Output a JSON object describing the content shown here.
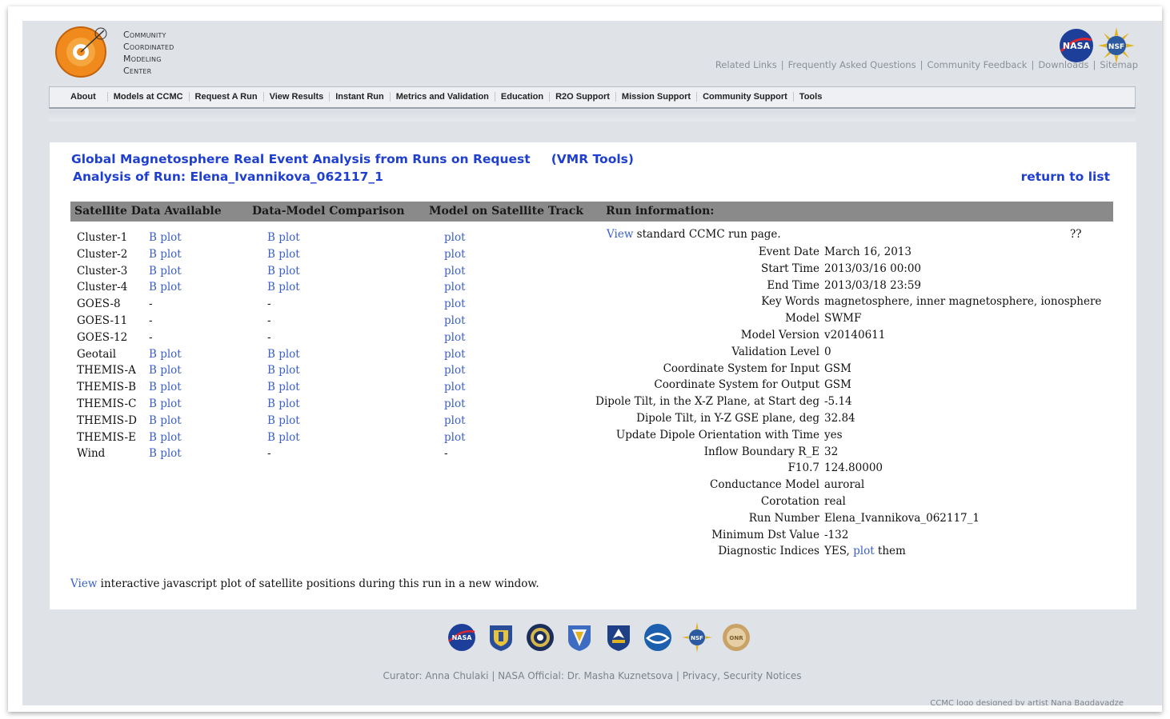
{
  "logo": {
    "lines": [
      "Community",
      "Coordinated",
      "Modeling",
      "Center"
    ]
  },
  "top_links": [
    "Related Links",
    "Frequently Asked Questions",
    "Community Feedback",
    "Downloads",
    "Sitemap"
  ],
  "nav": [
    "About",
    "Models at CCMC",
    "Request A Run",
    "View Results",
    "Instant Run",
    "Metrics and Validation",
    "Education",
    "R2O Support",
    "Mission Support",
    "Community Support",
    "Tools"
  ],
  "header": {
    "title": "Global Magnetosphere Real Event Analysis from Runs on Request",
    "vmr": "(VMR Tools)",
    "run_title": "Analysis of Run: Elena_Ivannikova_062117_1",
    "return": "return to list"
  },
  "table_headers": [
    "Satellite Data Available",
    "Data-Model Comparison",
    "Model on Satellite Track",
    "Run information:"
  ],
  "satellites": [
    {
      "name": "Cluster-1",
      "data": "B plot",
      "comparison": "B plot",
      "track": "plot"
    },
    {
      "name": "Cluster-2",
      "data": "B plot",
      "comparison": "B plot",
      "track": "plot"
    },
    {
      "name": "Cluster-3",
      "data": "B plot",
      "comparison": "B plot",
      "track": "plot"
    },
    {
      "name": "Cluster-4",
      "data": "B plot",
      "comparison": "B plot",
      "track": "plot"
    },
    {
      "name": "GOES-8",
      "data": "-",
      "comparison": "-",
      "track": "plot"
    },
    {
      "name": "GOES-11",
      "data": "-",
      "comparison": "-",
      "track": "plot"
    },
    {
      "name": "GOES-12",
      "data": "-",
      "comparison": "-",
      "track": "plot"
    },
    {
      "name": "Geotail",
      "data": "B plot",
      "comparison": "B plot",
      "track": "plot"
    },
    {
      "name": "THEMIS-A",
      "data": "B plot",
      "comparison": "B plot",
      "track": "plot"
    },
    {
      "name": "THEMIS-B",
      "data": "B plot",
      "comparison": "B plot",
      "track": "plot"
    },
    {
      "name": "THEMIS-C",
      "data": "B plot",
      "comparison": "B plot",
      "track": "plot"
    },
    {
      "name": "THEMIS-D",
      "data": "B plot",
      "comparison": "B plot",
      "track": "plot"
    },
    {
      "name": "THEMIS-E",
      "data": "B plot",
      "comparison": "B plot",
      "track": "plot"
    },
    {
      "name": "Wind",
      "data": "B plot",
      "comparison": "-",
      "track": "-"
    }
  ],
  "run_page": {
    "link": "View",
    "text": " standard CCMC run page.",
    "marker": "??"
  },
  "run_info": [
    {
      "label": "Event Date",
      "value": "March 16, 2013"
    },
    {
      "label": "Start Time",
      "value": "2013/03/16 00:00"
    },
    {
      "label": "End Time",
      "value": "2013/03/18 23:59"
    },
    {
      "label": "Key Words",
      "value": "magnetosphere, inner magnetosphere, ionosphere"
    },
    {
      "label": "Model",
      "value": "SWMF"
    },
    {
      "label": "Model Version",
      "value": "v20140611"
    },
    {
      "label": "Validation Level",
      "value": "0"
    },
    {
      "label": "Coordinate System for Input",
      "value": "GSM"
    },
    {
      "label": "Coordinate System for Output",
      "value": "GSM"
    },
    {
      "label": "Dipole Tilt, in the X-Z Plane, at Start deg",
      "value": "-5.14"
    },
    {
      "label": "Dipole Tilt, in Y-Z GSE plane, deg",
      "value": "32.84"
    },
    {
      "label": "Update Dipole Orientation with Time",
      "value": "yes"
    },
    {
      "label": "Inflow Boundary R_E",
      "value": "32"
    },
    {
      "label": "F10.7",
      "value": "124.80000"
    },
    {
      "label": "Conductance Model",
      "value": "auroral"
    },
    {
      "label": "Corotation",
      "value": "real"
    },
    {
      "label": "Run Number",
      "value": "Elena_Ivannikova_062117_1"
    },
    {
      "label": "Minimum Dst Value",
      "value": "-132"
    }
  ],
  "diagnostic": {
    "label": "Diagnostic Indices",
    "pre": "YES, ",
    "link": "plot",
    "post": " them"
  },
  "footer_view": {
    "link": "View",
    "text": " interactive javascript plot of satellite positions during this run in a new window."
  },
  "seals": [
    "nasa-seal-icon",
    "air-force-seal-icon",
    "dod-seal-icon",
    "afrl-seal-icon",
    "afosr-seal-icon",
    "noaa-seal-icon",
    "nsf-seal-icon",
    "onr-seal-icon"
  ],
  "curator": "Curator: Anna Chulaki | NASA Official: Dr. Masha Kuznetsova | Privacy, Security Notices",
  "credit": "CCMC logo designed by artist Nana Bagdavadze",
  "colors": {
    "link": "#3a5fc8",
    "title": "#1e3fd0",
    "header_bar": "#8a8a8a",
    "background": "#dfe3e8"
  }
}
